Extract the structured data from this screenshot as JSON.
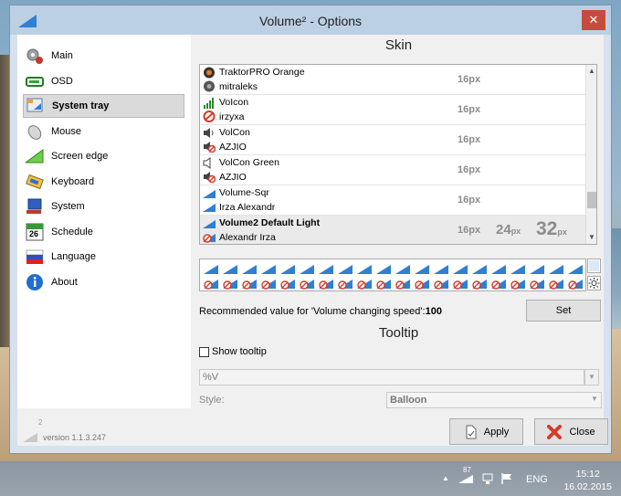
{
  "window": {
    "title": "Volume² - Options",
    "close_symbol": "✕"
  },
  "sidebar": {
    "items": [
      {
        "label": "Main",
        "icon": "gears-icon"
      },
      {
        "label": "OSD",
        "icon": "osd-bar-icon"
      },
      {
        "label": "System tray",
        "icon": "tray-icon",
        "active": true
      },
      {
        "label": "Mouse",
        "icon": "mouse-icon"
      },
      {
        "label": "Screen edge",
        "icon": "screen-edge-icon"
      },
      {
        "label": "Keyboard",
        "icon": "keyboard-icon"
      },
      {
        "label": "System",
        "icon": "monitor-icon"
      },
      {
        "label": "Schedule",
        "icon": "calendar-icon",
        "badge": "26"
      },
      {
        "label": "Language",
        "icon": "flag-icon"
      },
      {
        "label": "About",
        "icon": "info-icon"
      }
    ],
    "version_logo_digit": "2",
    "version": "version 1.1.3.247"
  },
  "skin": {
    "title": "Skin",
    "rows": [
      {
        "name": "TraktorPRO Orange",
        "author": "mitraleks",
        "size16": "16px"
      },
      {
        "name": "VoIcon",
        "author": "irzyxa",
        "size16": "16px"
      },
      {
        "name": "VolCon",
        "author": "AZJIO",
        "size16": "16px"
      },
      {
        "name": "VolCon Green",
        "author": "AZJIO",
        "size16": "16px"
      },
      {
        "name": "Volume-Sqr",
        "author": "Irza Alexandr",
        "size16": "16px"
      },
      {
        "name": "Volume2 Default Light",
        "author": "Alexandr Irza",
        "size16": "16px",
        "size24": "24",
        "size32": "32",
        "px": "px",
        "selected": true
      }
    ],
    "recommended_prefix": "Recommended value for 'Volume changing speed':",
    "recommended_value": "100",
    "set_button": "Set"
  },
  "tooltip": {
    "title": "Tooltip",
    "show_label": "Show tooltip",
    "show_checked": false,
    "format_value": "%V",
    "style_label": "Style:",
    "style_value": "Balloon"
  },
  "buttons": {
    "apply": "Apply",
    "close": "Close"
  },
  "taskbar": {
    "tray_caret": "▲",
    "volume_number": "87",
    "language": "ENG",
    "time": "15:12",
    "date": "16.02.2015"
  },
  "colors": {
    "accent_blue": "#2f7fd3",
    "mute_red": "#d63b2a",
    "close_red": "#c74b3d"
  }
}
